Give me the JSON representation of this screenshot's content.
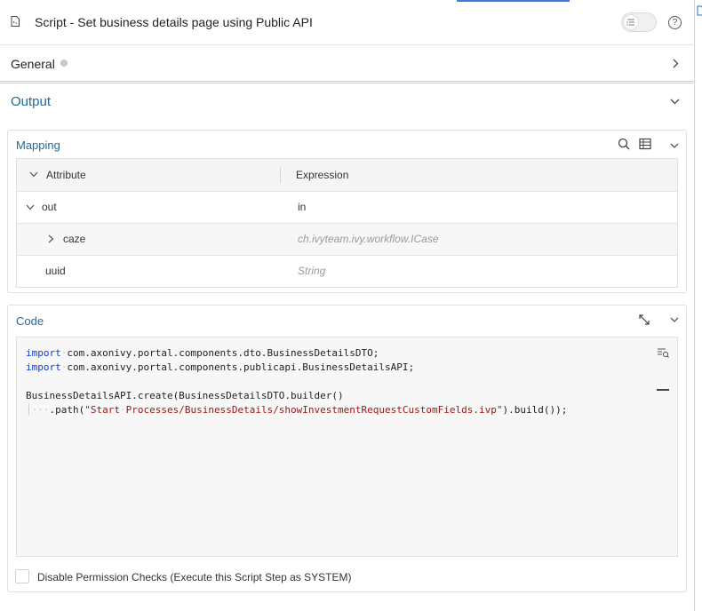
{
  "header": {
    "title": "Script - Set business details page using Public API",
    "file_icon": "file-icon",
    "toggle_icon": "list-toggle-icon",
    "help_icon": "help-icon",
    "help_glyph": "?"
  },
  "general": {
    "label": "General",
    "status_icon": "status-dot-icon",
    "chevron_icon": "chevron-right-icon"
  },
  "output": {
    "title": "Output",
    "chevron_icon": "chevron-down-icon",
    "mapping": {
      "title": "Mapping",
      "columns": [
        "Attribute",
        "Expression"
      ],
      "rows": [
        {
          "attribute": "out",
          "expression": "in",
          "expanded": true
        },
        {
          "attribute": "caze",
          "expression": "ch.ivyteam.ivy.workflow.ICase",
          "expanded": false
        },
        {
          "attribute": "uuid",
          "expression": "String"
        }
      ],
      "icons": [
        "search-icon",
        "table-icon",
        "chevron-down-icon"
      ]
    },
    "code": {
      "title": "Code",
      "lines": [
        "import com.axonivy.portal.components.dto.BusinessDetailsDTO;",
        "import com.axonivy.portal.components.publicapi.BusinessDetailsAPI;",
        "",
        "BusinessDetailsAPI.create(BusinessDetailsDTO.builder()",
        "    .path(\"Start Processes/BusinessDetails/showInvestmentRequestCustomFields.ivp\").build());"
      ],
      "icons": [
        "expand-icon",
        "chevron-down-icon",
        "browse-icon",
        "minimize-icon"
      ],
      "disable_permission_label": "Disable Permission Checks (Execute this Script Step as SYSTEM)",
      "disable_permission_checked": false
    }
  },
  "colors": {
    "accent": "#1f6a96",
    "keyword": "#0b3ecf",
    "string": "#a31515"
  }
}
